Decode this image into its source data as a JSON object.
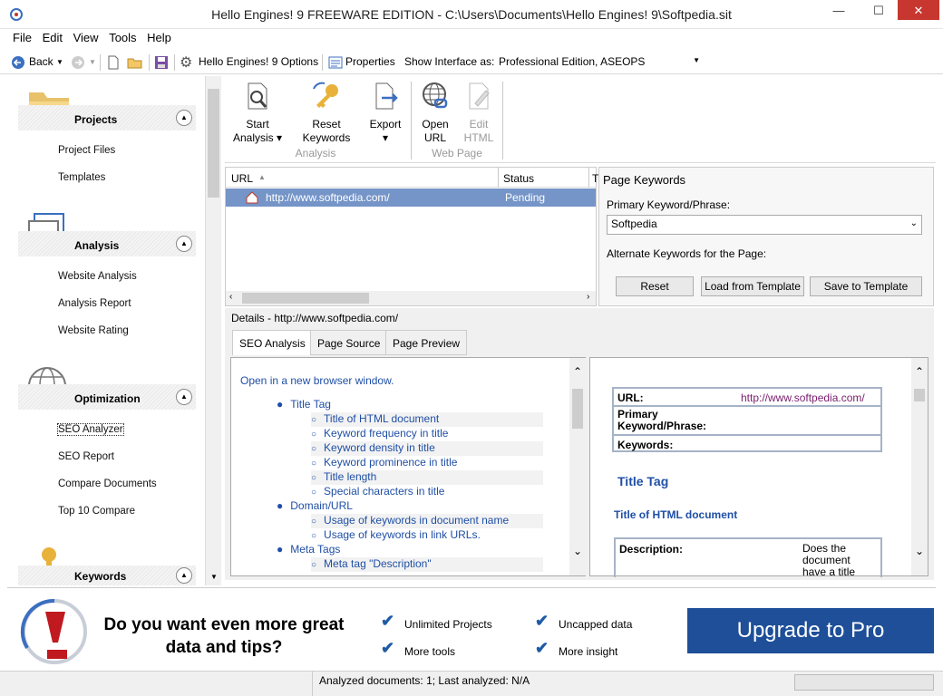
{
  "window": {
    "title": "Hello Engines! 9 FREEWARE EDITION - C:\\Users\\Documents\\Hello Engines! 9\\Softpedia.sit",
    "min": "—",
    "max": "☐",
    "close": "✕"
  },
  "menu": [
    "File",
    "Edit",
    "View",
    "Tools",
    "Help"
  ],
  "toolbar": {
    "back_label": "Back",
    "options_label": "Hello Engines! 9 Options",
    "properties_label": "Properties",
    "show_interface_label": "Show Interface as:",
    "interface_value": "Professional Edition, ASEOPS"
  },
  "sidebar": {
    "sections": [
      {
        "title": "Projects",
        "items": [
          "Project Files",
          "Templates"
        ]
      },
      {
        "title": "Analysis",
        "items": [
          "Website Analysis",
          "Analysis Report",
          "Website Rating"
        ]
      },
      {
        "title": "Optimization",
        "items": [
          "SEO Analyzer",
          "SEO Report",
          "Compare Documents",
          "Top 10 Compare"
        ]
      },
      {
        "title": "Keywords",
        "items": []
      }
    ]
  },
  "ribbon": {
    "start_analysis": "Start\nAnalysis ▾",
    "reset_keywords": "Reset\nKeywords",
    "export": "Export\n▾",
    "open_url": "Open\nURL",
    "edit_html": "Edit\nHTML",
    "group_analysis": "Analysis",
    "group_web": "Web Page"
  },
  "list": {
    "col_url": "URL",
    "col_status": "Status",
    "col_extra": "T",
    "row_url": "http://www.softpedia.com/",
    "row_status": "Pending"
  },
  "keywords": {
    "title": "Page Keywords",
    "primary_label": "Primary Keyword/Phrase:",
    "primary_value": "Softpedia",
    "alternate_label": "Alternate Keywords for the Page:",
    "reset": "Reset",
    "load": "Load from Template",
    "save": "Save to Template"
  },
  "details": {
    "title": "Details - http://www.softpedia.com/",
    "tabs": [
      "SEO Analysis",
      "Page Source",
      "Page Preview"
    ],
    "open_link": "Open in a new browser window.",
    "tree": [
      {
        "label": "Title Tag",
        "children": [
          "Title of HTML document",
          "Keyword frequency in title",
          "Keyword density in title",
          "Keyword prominence in title",
          "Title length",
          "Special characters in title"
        ]
      },
      {
        "label": "Domain/URL",
        "children": [
          "Usage of keywords in document name",
          "Usage of keywords in link URLs."
        ]
      },
      {
        "label": "Meta Tags",
        "children": [
          "Meta tag \"Description\""
        ]
      }
    ],
    "preview": {
      "url_label": "URL:",
      "url_value": "http://www.softpedia.com/",
      "pk_label": "Primary Keyword/Phrase:",
      "kw_label": "Keywords:",
      "title_tag": "Title Tag",
      "title_doc": "Title of HTML document",
      "desc_label": "Description:",
      "desc_value": "Does the document have a title"
    }
  },
  "banner": {
    "headline": "Do you want even more great data and tips?",
    "features": [
      "Unlimited Projects",
      "Uncapped data",
      "More tools",
      "More insight"
    ],
    "upgrade": "Upgrade to Pro"
  },
  "statusbar": {
    "text": "Analyzed documents: 1; Last analyzed: N/A"
  }
}
